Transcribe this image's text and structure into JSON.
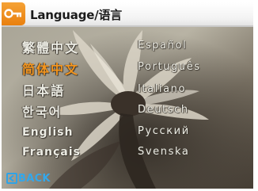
{
  "header": {
    "title": "Language/语言",
    "icon": "key-icon",
    "accent": "#f3951f"
  },
  "languages": {
    "left": [
      "繁體中文",
      "简体中文",
      "日本語",
      "한국어",
      "English",
      "Français"
    ],
    "right": [
      "Español",
      "Português",
      "Italiano",
      "Deutsch",
      "Русский",
      "Svenska"
    ],
    "selected": "简体中文"
  },
  "footer": {
    "back_label": "BACK",
    "icon": "back-arrow-icon",
    "color": "#2fa3e6"
  }
}
